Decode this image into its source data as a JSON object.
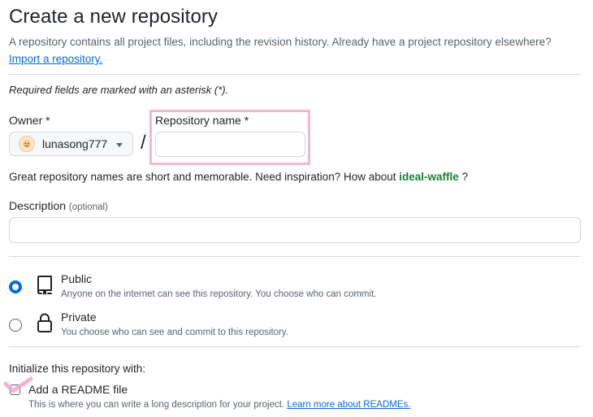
{
  "header": {
    "title": "Create a new repository",
    "subtitle": "A repository contains all project files, including the revision history. Already have a project repository elsewhere?",
    "import_link": "Import a repository."
  },
  "form": {
    "required_note": "Required fields are marked with an asterisk (*).",
    "owner": {
      "label": "Owner *",
      "value": "lunasong777",
      "avatar_icon": "user-avatar-icon"
    },
    "separator": "/",
    "repo_name": {
      "label": "Repository name *",
      "value": "",
      "placeholder": ""
    },
    "hint": {
      "text": "Great repository names are short and memorable. Need inspiration? How about ",
      "suggestion": "ideal-waffle",
      "suffix": " ?"
    },
    "description": {
      "label": "Description",
      "optional": "(optional)",
      "value": "",
      "placeholder": ""
    },
    "visibility": [
      {
        "title": "Public",
        "description": "Anyone on the internet can see this repository. You choose who can commit.",
        "icon": "repo-icon",
        "selected": true
      },
      {
        "title": "Private",
        "description": "You choose who can see and commit to this repository.",
        "icon": "lock-icon",
        "selected": false
      }
    ],
    "initialize": {
      "label": "Initialize this repository with:",
      "readme": {
        "label": "Add a README file",
        "checked": false,
        "description": "This is where you can write a long description for your project.",
        "link": "Learn more about READMEs."
      }
    }
  },
  "colors": {
    "accent": "#0969da",
    "suggestion": "#1a7f37",
    "highlight": "#f2b6cf",
    "border": "#d1d9e0",
    "muted_text": "#59636e"
  }
}
